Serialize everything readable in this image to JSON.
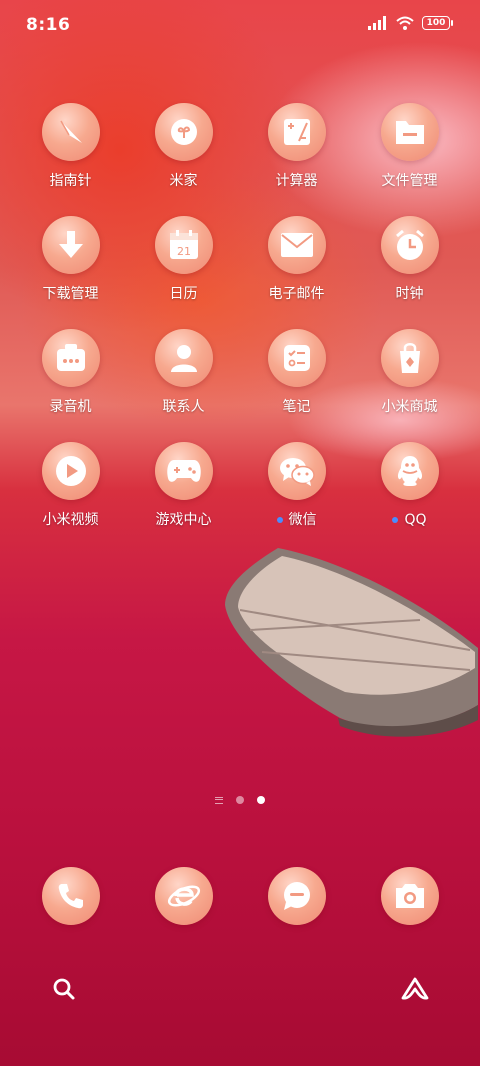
{
  "status_bar": {
    "time": "8:16",
    "battery": "100",
    "icons": [
      "signal-icon",
      "wifi-icon",
      "battery-icon"
    ]
  },
  "apps": [
    {
      "label": "指南针",
      "icon": "compass-icon"
    },
    {
      "label": "米家",
      "icon": "mijia-icon"
    },
    {
      "label": "计算器",
      "icon": "calculator-icon"
    },
    {
      "label": "文件管理",
      "icon": "folder-icon"
    },
    {
      "label": "下载管理",
      "icon": "download-icon"
    },
    {
      "label": "日历",
      "icon": "calendar-icon",
      "badge": "21"
    },
    {
      "label": "电子邮件",
      "icon": "mail-icon"
    },
    {
      "label": "时钟",
      "icon": "clock-icon"
    },
    {
      "label": "录音机",
      "icon": "recorder-icon"
    },
    {
      "label": "联系人",
      "icon": "contacts-icon"
    },
    {
      "label": "笔记",
      "icon": "notes-icon"
    },
    {
      "label": "小米商城",
      "icon": "shopping-bag-icon"
    },
    {
      "label": "小米视频",
      "icon": "play-icon"
    },
    {
      "label": "游戏中心",
      "icon": "gamepad-icon"
    },
    {
      "label": "微信",
      "icon": "wechat-icon",
      "new_indicator": true
    },
    {
      "label": "QQ",
      "icon": "qq-icon",
      "new_indicator": true
    }
  ],
  "dock": [
    {
      "icon": "phone-icon"
    },
    {
      "icon": "browser-icon"
    },
    {
      "icon": "message-icon"
    },
    {
      "icon": "camera-icon"
    }
  ],
  "pager": {
    "pages": 2,
    "active": 2
  },
  "search_bar": {
    "left_icon": "search-icon",
    "right_icon": "assistant-icon"
  },
  "colors": {
    "icon_bg": "#f7a98f",
    "glyph": "#ffffff",
    "new_dot": "#4a8dff"
  }
}
